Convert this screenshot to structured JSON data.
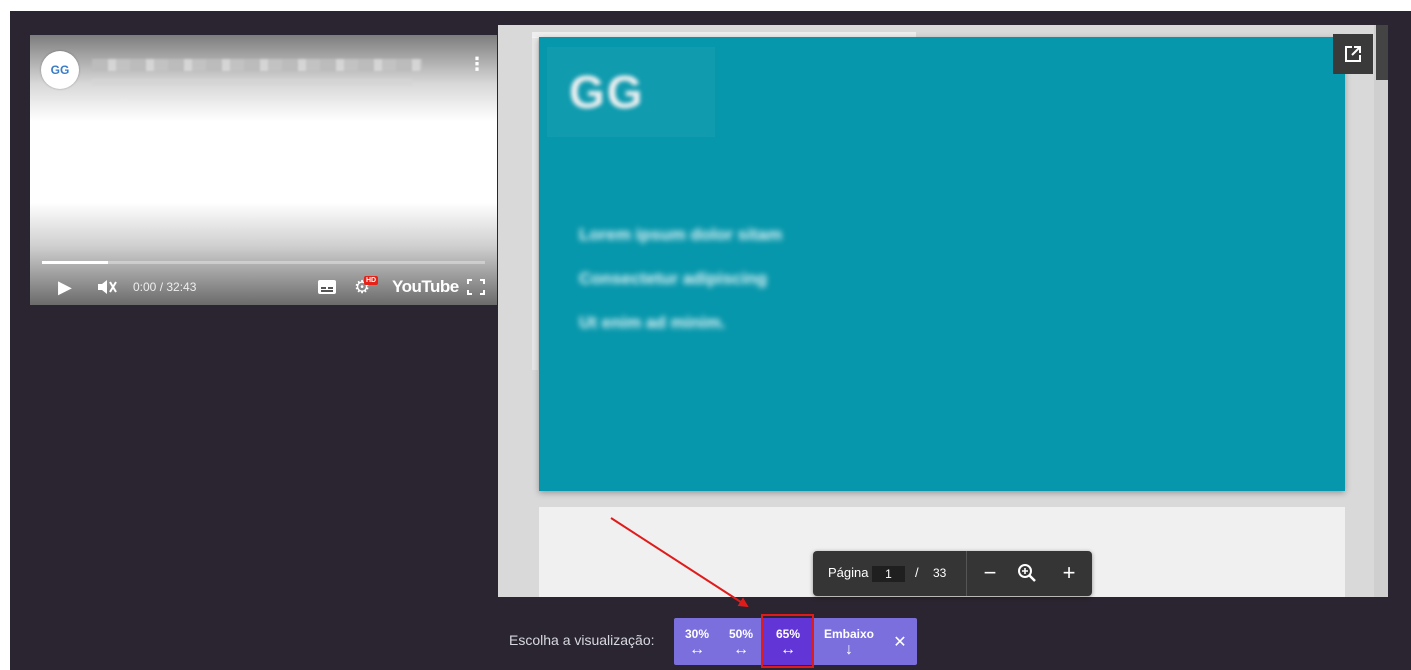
{
  "video": {
    "channel_logo": "GG",
    "time": "0:00 / 32:43",
    "youtube_label": "YouTube",
    "hd_badge": "HD",
    "progress_fraction": 0.15,
    "icons": [
      "play-icon",
      "mute-icon",
      "captions-icon",
      "settings-icon",
      "fullscreen-icon",
      "more-options-icon"
    ]
  },
  "pdf": {
    "page_logo": "GG",
    "blurred_lines": [
      "Lorem ipsum dolor sitam",
      "Consectetur adipiscing",
      "Ut enim ad minim."
    ],
    "toolbar": {
      "page_label": "Página",
      "current_page": "1",
      "separator": "/",
      "total_pages": "33",
      "zoom_out": "−",
      "zoom_in": "+"
    },
    "icons": [
      "open-external-icon",
      "zoom-out-icon",
      "zoom-icon",
      "zoom-in-icon"
    ]
  },
  "view_chooser": {
    "label": "Escolha a visualização:",
    "options": [
      {
        "label": "30%",
        "icon": "↔"
      },
      {
        "label": "50%",
        "icon": "↔"
      },
      {
        "label": "65%",
        "icon": "↔",
        "selected": true
      },
      {
        "label": "Embaixo",
        "icon": "↓"
      }
    ],
    "close": "✕",
    "accent": "#7a6fdc",
    "selected_color": "#6236d6"
  },
  "annotation": {
    "color": "#e01b1b"
  }
}
